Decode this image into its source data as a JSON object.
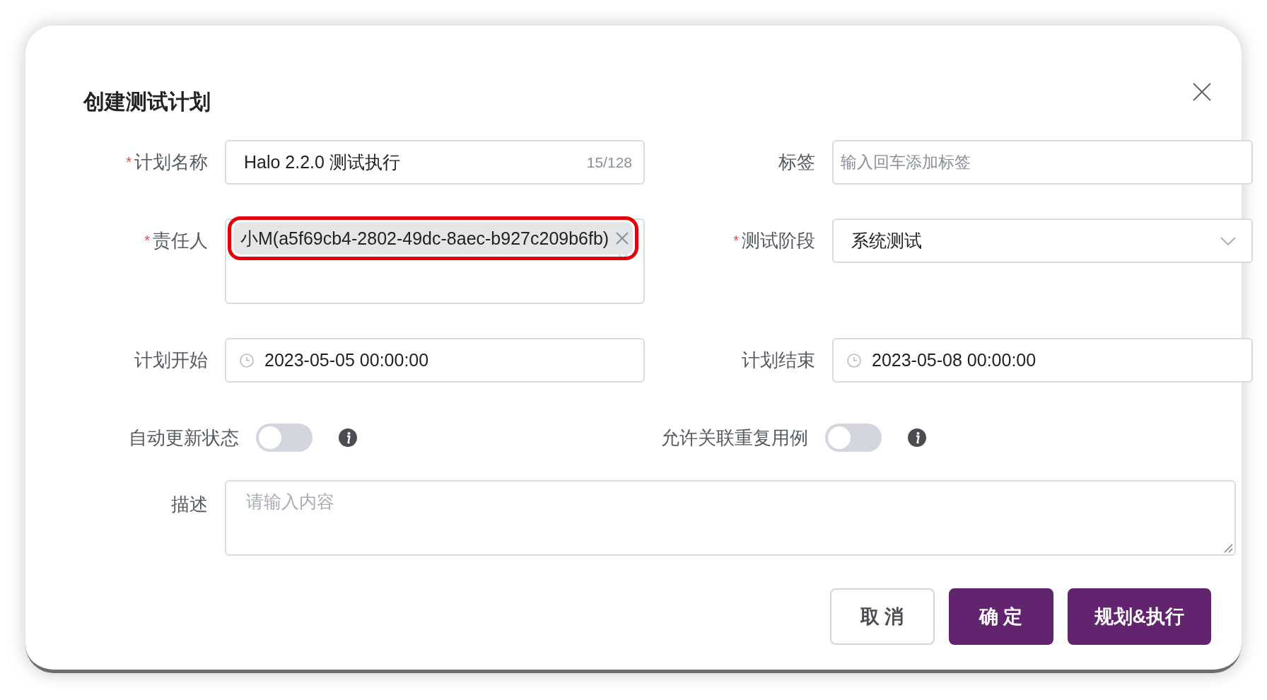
{
  "dialog": {
    "title": "创建测试计划"
  },
  "fields": [
    {
      "kind": "text",
      "label": "计划名称",
      "mark": "*",
      "value": "Halo 2.2.0 测试执行",
      "counter": "15/128"
    },
    {
      "kind": "tags",
      "label": "标签",
      "placeholder": "输入回车添加标签"
    },
    {
      "kind": "user",
      "label": "责任人",
      "mark": "*",
      "tag": "小M(a5f69cb4-2802-49dc-8aec-b927c209b6fb)",
      "highlighted": true
    },
    {
      "kind": "select",
      "label": "测试阶段",
      "mark": "*",
      "value": "系统测试"
    },
    {
      "kind": "date",
      "label": "计划开始",
      "value": "2023-05-05 00:00:00"
    },
    {
      "kind": "date",
      "label": "计划结束",
      "value": "2023-05-08 00:00:00"
    }
  ],
  "switches": [
    {
      "label": "自动更新状态",
      "on": false
    },
    {
      "label": "允许关联重复用例",
      "on": false
    }
  ],
  "description": {
    "label": "描述",
    "placeholder": "请输入内容"
  },
  "buttons": [
    {
      "label": "取 消",
      "kind": "default"
    },
    {
      "label": "确 定",
      "kind": "primary"
    },
    {
      "label": "规划&执行",
      "kind": "primary"
    }
  ]
}
